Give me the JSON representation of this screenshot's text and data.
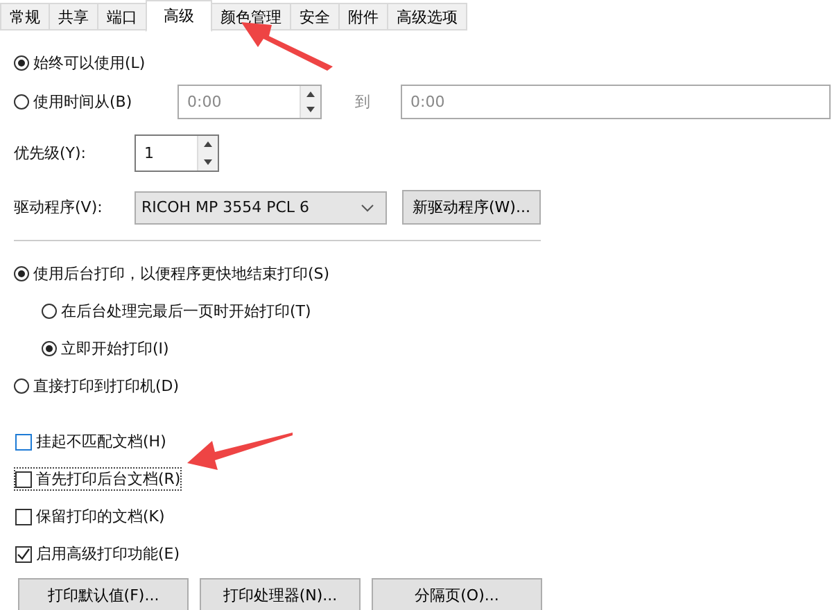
{
  "tabs": [
    {
      "label": "常规",
      "selected": false
    },
    {
      "label": "共享",
      "selected": false
    },
    {
      "label": "端口",
      "selected": false
    },
    {
      "label": "高级",
      "selected": true
    },
    {
      "label": "颜色管理",
      "selected": false
    },
    {
      "label": "安全",
      "selected": false
    },
    {
      "label": "附件",
      "selected": false
    },
    {
      "label": "高级选项",
      "selected": false
    }
  ],
  "availability": {
    "options": [
      {
        "label": "始终可以使用(L)",
        "selected": true
      },
      {
        "label": "使用时间从(B)",
        "selected": false
      }
    ],
    "from": {
      "value": "0:00",
      "disabled": true
    },
    "to_label": "到",
    "to": {
      "value": "0:00",
      "disabled": true
    }
  },
  "priority": {
    "label": "优先级(Y):",
    "value": "1"
  },
  "driver": {
    "label": "驱动程序(V):",
    "value": "RICOH MP 3554 PCL 6",
    "button": "新驱动程序(W)..."
  },
  "spool": [
    {
      "label": "使用后台打印，以便程序更快地结束打印(S)",
      "selected": true,
      "children": [
        {
          "label": "在后台处理完最后一页时开始打印(T)",
          "selected": false
        },
        {
          "label": "立即开始打印(I)",
          "selected": true
        }
      ]
    },
    {
      "label": "直接打印到打印机(D)",
      "selected": false
    }
  ],
  "checkboxes": [
    {
      "label": "挂起不匹配文档(H)",
      "checked": false,
      "focused": false
    },
    {
      "label": "首先打印后台文档(R)",
      "checked": false,
      "focused": true
    },
    {
      "label": "保留打印的文档(K)",
      "checked": false,
      "focused": false
    },
    {
      "label": "启用高级打印功能(E)",
      "checked": true,
      "focused": false
    }
  ],
  "buttons": [
    "打印默认值(F)...",
    "打印处理器(N)...",
    "分隔页(O)..."
  ]
}
